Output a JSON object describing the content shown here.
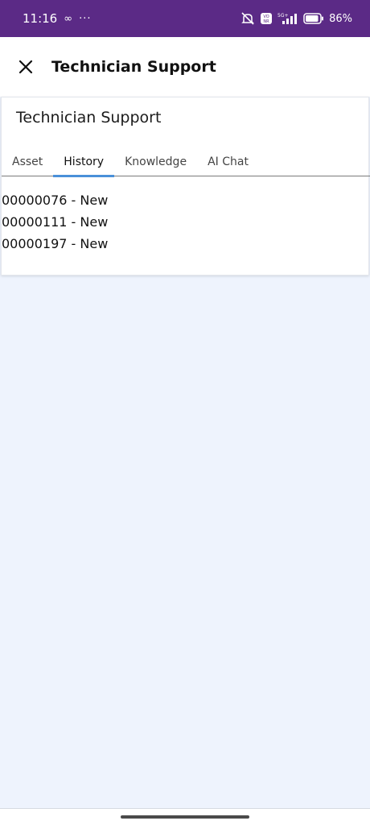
{
  "status_bar": {
    "time": "11:16",
    "loop_glyph": "∞",
    "dots": "···",
    "battery_percent": "86%",
    "network": "5G+",
    "icons": [
      "mute-icon",
      "volte-icon",
      "signal-icon",
      "battery-icon"
    ]
  },
  "header": {
    "title": "Technician Support",
    "close_icon": "close-icon"
  },
  "card": {
    "title": "Technician Support",
    "tabs": [
      {
        "label": "Asset",
        "active": false
      },
      {
        "label": "History",
        "active": true
      },
      {
        "label": "Knowledge",
        "active": false
      },
      {
        "label": "AI Chat",
        "active": false
      }
    ],
    "items": [
      {
        "label": "00000076 - New"
      },
      {
        "label": "00000111 - New"
      },
      {
        "label": "00000197 - New"
      }
    ]
  },
  "colors": {
    "status_bar": "#5b2a86",
    "page_background": "#eef3fd",
    "tab_indicator": "#4a90d9"
  }
}
